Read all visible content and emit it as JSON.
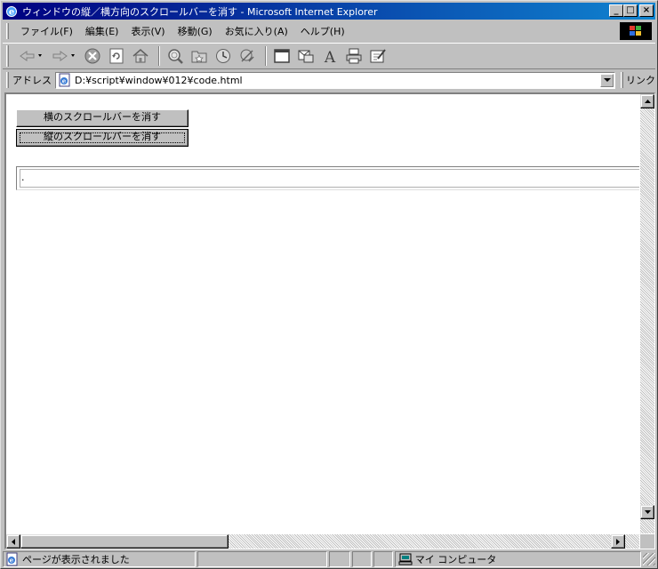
{
  "window": {
    "title": "ウィンドウの縦／横方向のスクロールバーを消す - Microsoft Internet Explorer",
    "minimize_glyph": "_",
    "maximize_glyph": "□",
    "close_glyph": "×"
  },
  "menu": {
    "items": [
      {
        "label": "ファイル(F)"
      },
      {
        "label": "編集(E)"
      },
      {
        "label": "表示(V)"
      },
      {
        "label": "移動(G)"
      },
      {
        "label": "お気に入り(A)"
      },
      {
        "label": "ヘルプ(H)"
      }
    ]
  },
  "toolbar": {
    "icons": [
      "back-icon",
      "forward-icon",
      "stop-icon",
      "refresh-icon",
      "home-icon",
      "search-icon",
      "favorites-icon",
      "history-icon",
      "channels-icon",
      "fullscreen-icon",
      "mail-icon",
      "font-icon",
      "print-icon",
      "edit-icon"
    ]
  },
  "address": {
    "label": "アドレス",
    "url": "D:¥script¥window¥012¥code.html",
    "links_label": "リンク"
  },
  "page": {
    "button_horizontal": "横のスクロールバーを消す",
    "button_vertical": "縦のスクロールバーを消す",
    "output_text": "."
  },
  "status": {
    "message": "ページが表示されました",
    "zone": "マイ コンピュータ"
  },
  "colors": {
    "title_start": "#000080",
    "title_end": "#1084d0",
    "chrome": "#c0c0c0"
  }
}
